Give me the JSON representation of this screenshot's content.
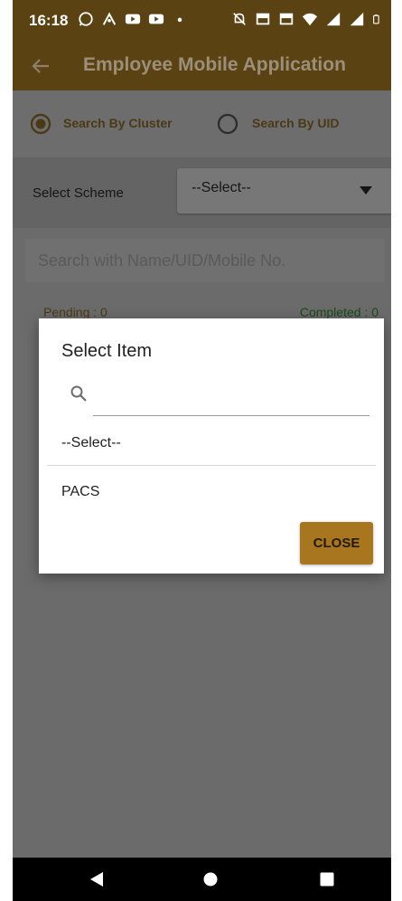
{
  "status_bar": {
    "time": "16:18",
    "left_icons": [
      "whatsapp-icon",
      "app-icon",
      "youtube-icon",
      "youtube-icon",
      "dot-icon"
    ],
    "right_icons": [
      "mute-icon",
      "volte-icon",
      "volte-icon",
      "wifi-icon",
      "signal-icon",
      "signal-icon",
      "battery-icon"
    ]
  },
  "app_bar": {
    "title": "Employee Mobile Application",
    "back_icon": "arrow-left-icon"
  },
  "search_mode": {
    "options": [
      {
        "label": "Search By Cluster",
        "selected": true
      },
      {
        "label": "Search By UID",
        "selected": false
      }
    ]
  },
  "scheme": {
    "label": "Select Scheme",
    "value": "--Select--"
  },
  "search": {
    "placeholder": "Search with Name/UID/Mobile No."
  },
  "counts": {
    "pending": "Pending : 0",
    "completed": "Completed : 0"
  },
  "dialog": {
    "title": "Select Item",
    "options": [
      "--Select--",
      "PACS"
    ],
    "close_label": "CLOSE"
  },
  "nav_bar": {
    "icons": [
      "back-icon",
      "home-icon",
      "recents-icon"
    ]
  },
  "colors": {
    "brand": "#a8761e",
    "appbar": "#5a4212",
    "scrim": "#6b6b6b"
  }
}
